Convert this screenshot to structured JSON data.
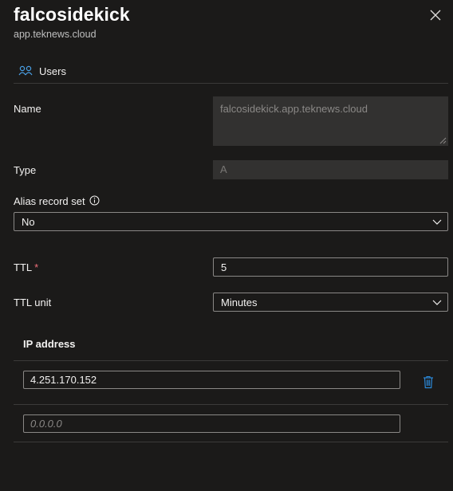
{
  "header": {
    "title": "falcosidekick",
    "subtitle": "app.teknews.cloud"
  },
  "toolbar": {
    "users_label": "Users"
  },
  "form": {
    "name_label": "Name",
    "name_value": "falcosidekick.app.teknews.cloud",
    "type_label": "Type",
    "type_value": "A",
    "alias_label": "Alias record set",
    "alias_value": "No",
    "ttl_label": "TTL",
    "ttl_required": "*",
    "ttl_value": "5",
    "ttl_unit_label": "TTL unit",
    "ttl_unit_value": "Minutes"
  },
  "ip_table": {
    "header": "IP address",
    "rows": [
      {
        "value": "4.251.170.152"
      }
    ],
    "new_row_placeholder": "0.0.0.0"
  },
  "colors": {
    "background": "#1b1a19",
    "accent": "#0078d4",
    "required": "#f1707b"
  }
}
